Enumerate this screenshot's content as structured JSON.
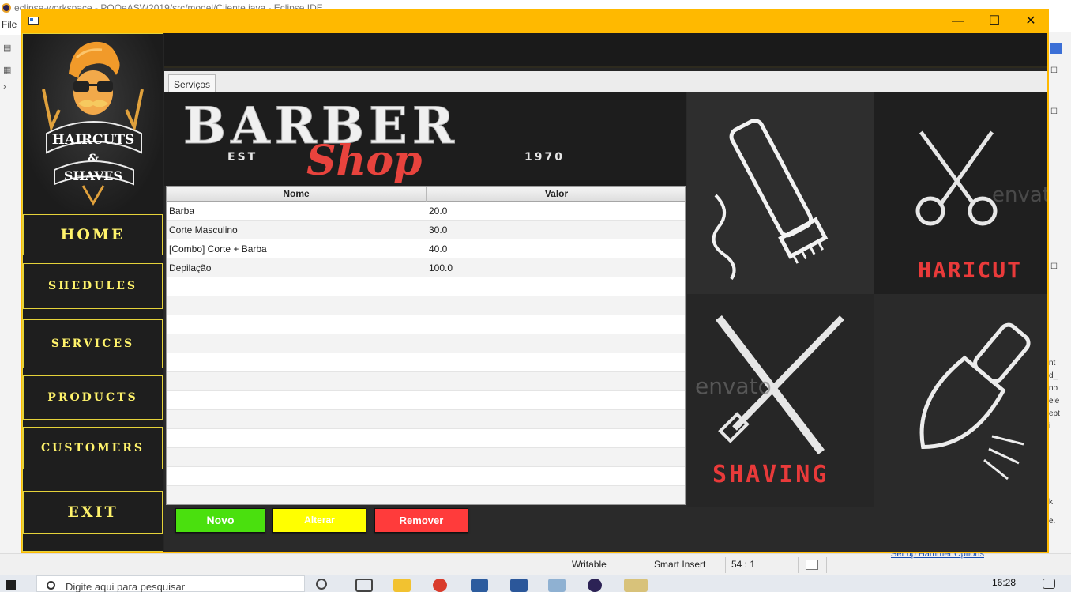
{
  "eclipse": {
    "title": "eclipse-workspace - POOeASW2019/src/model/Cliente.java - Eclipse IDE",
    "menu_file": "File",
    "status": {
      "writable": "Writable",
      "insert_mode": "Smart Insert",
      "position": "54 : 1"
    },
    "right_snippets": [
      "nt",
      "d_",
      "no",
      "ele",
      "ept",
      "i",
      "k",
      "e."
    ],
    "hint_link": "Set up Hammer Options"
  },
  "taskbar": {
    "search_placeholder": "Digite aqui para pesquisar",
    "clock": "16:28"
  },
  "app": {
    "window_controls": {
      "minimize": "—",
      "maximize": "☐",
      "close": "✕"
    },
    "logo": {
      "line1": "HAIRCUTS",
      "amp": "&",
      "line2": "SHAVES"
    },
    "nav": [
      {
        "label": "HOME"
      },
      {
        "label": "SHEDULES"
      },
      {
        "label": "SERVICES"
      },
      {
        "label": "PRODUCTS"
      },
      {
        "label": "CUSTOMERS"
      },
      {
        "label": "EXIT"
      }
    ],
    "tab": "Serviços",
    "banner": {
      "title": "BARBER",
      "script": "Shop",
      "est": "EST",
      "year": "1970"
    },
    "tiles": {
      "haircut": "HARICUT",
      "shaving": "SHAVING",
      "watermark": "envato"
    },
    "table": {
      "columns": [
        "Nome",
        "Valor"
      ],
      "rows": [
        [
          "Barba",
          "20.0"
        ],
        [
          "Corte Masculino",
          "30.0"
        ],
        [
          "[Combo] Corte + Barba",
          "40.0"
        ],
        [
          "Depilação",
          "100.0"
        ]
      ]
    },
    "buttons": {
      "novo": "Novo",
      "alterar": "Alterar",
      "remover": "Remover"
    },
    "colors": {
      "accent": "#ffb900",
      "nav_text": "#fff36b",
      "novo": "#4ae00e",
      "alterar": "#ffff00",
      "remover": "#ff3b3b"
    }
  }
}
